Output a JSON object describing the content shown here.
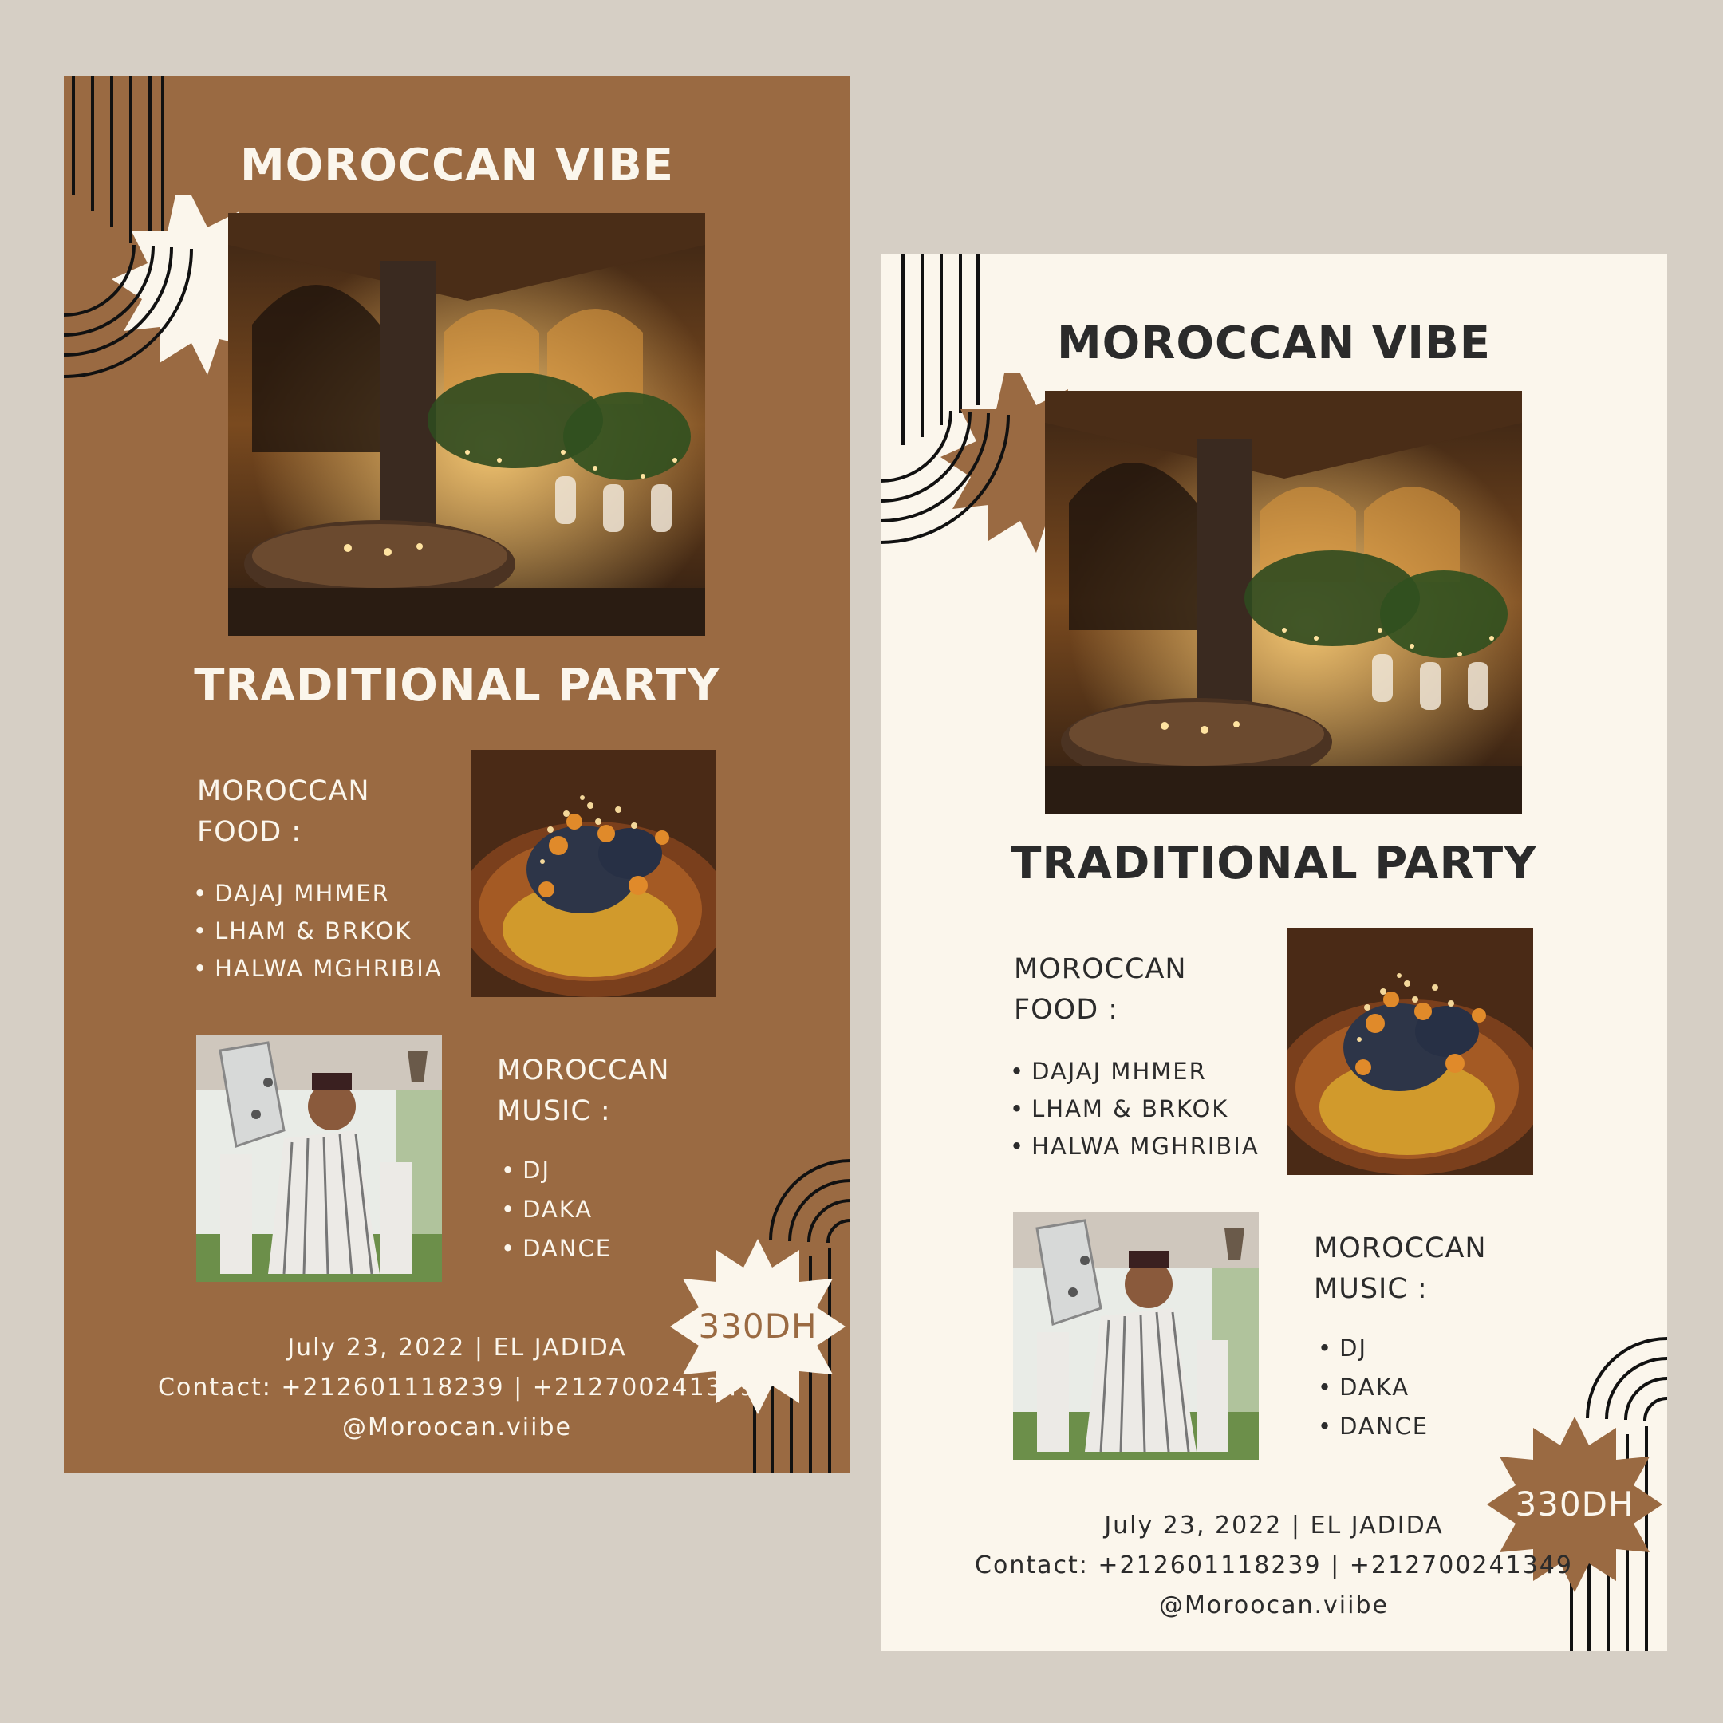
{
  "colors": {
    "background": "#d6cfc5",
    "brown": "#9a6a42",
    "cream": "#fbf6ec",
    "dark": "#2b2b2b",
    "line": "#111111"
  },
  "posters": [
    {
      "variant": "brown",
      "title": "MOROCCAN VIBE",
      "subtitle": "TRADITIONAL PARTY",
      "food_title_line1": "MOROCCAN",
      "food_title_line2": "FOOD :",
      "food_items": [
        "DAJAJ MHMER",
        "LHAM & BRKOK",
        "HALWA MGHRIBIA"
      ],
      "music_title_line1": "MOROCCAN",
      "music_title_line2": "MUSIC :",
      "music_items": [
        "DJ",
        "DAKA",
        "DANCE"
      ],
      "price": "330DH",
      "date_line": "July 23, 2022 | EL JADIDA",
      "contact_line": "Contact: +212601118239 | +212700241349",
      "handle": "@Moroocan.viibe"
    },
    {
      "variant": "cream",
      "title": "MOROCCAN VIBE",
      "subtitle": "TRADITIONAL PARTY",
      "food_title_line1": "MOROCCAN",
      "food_title_line2": "FOOD :",
      "food_items": [
        "DAJAJ MHMER",
        "LHAM & BRKOK",
        "HALWA MGHRIBIA"
      ],
      "music_title_line1": "MOROCCAN",
      "music_title_line2": "MUSIC :",
      "music_items": [
        "DJ",
        "DAKA",
        "DANCE"
      ],
      "price": "330DH",
      "date_line": "July 23, 2022 | EL JADIDA",
      "contact_line": "Contact: +212601118239 | +212700241349",
      "handle": "@Moroocan.viibe"
    }
  ],
  "bullet": "•"
}
